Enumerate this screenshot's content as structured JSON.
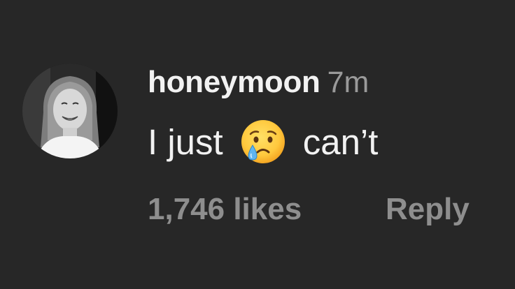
{
  "comment": {
    "username": "honeymoon",
    "timestamp": "7m",
    "text_before": "I just",
    "emoji": "crying-face",
    "text_after": "can’t",
    "likes": "1,746 likes",
    "reply_label": "Reply",
    "avatar_icon": "profile-photo"
  },
  "colors": {
    "background": "#272727",
    "primary_text": "#f2f2f2",
    "secondary_text": "#8e8e8e"
  }
}
